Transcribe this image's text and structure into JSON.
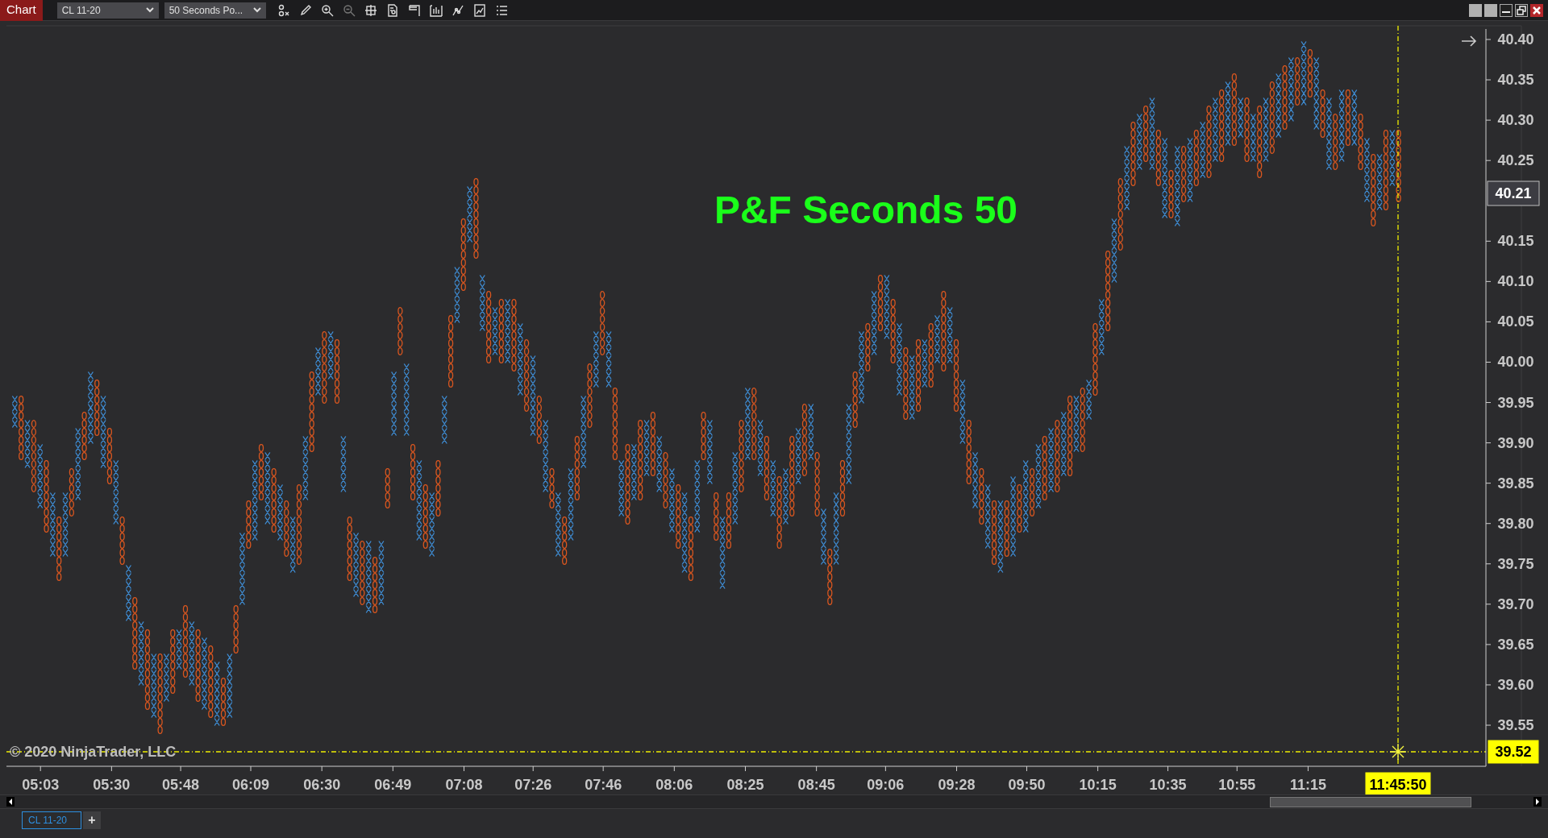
{
  "toolbar": {
    "app_tab": "Chart",
    "instrument": "CL 11-20",
    "bar_type": "50 Seconds Po..."
  },
  "chart": {
    "title": "P&F Seconds 50",
    "price_ticks": [
      "40.40",
      "40.35",
      "40.30",
      "40.25",
      "40.15",
      "40.10",
      "40.05",
      "40.00",
      "39.95",
      "39.90",
      "39.85",
      "39.80",
      "39.75",
      "39.70",
      "39.65",
      "39.60",
      "39.55"
    ],
    "time_ticks": [
      "05:03",
      "05:30",
      "05:48",
      "06:09",
      "06:30",
      "06:49",
      "07:08",
      "07:26",
      "07:46",
      "08:06",
      "08:25",
      "08:45",
      "09:06",
      "09:28",
      "09:50",
      "10:15",
      "10:35",
      "10:55",
      "11:15"
    ],
    "current_price": "40.21",
    "crosshair_price": "39.52",
    "crosshair_time": "11:45:50",
    "copyright": "© 2020 NinjaTrader, LLC"
  },
  "bottom_tabs": [
    {
      "label": "CL 11-20",
      "selected": true
    }
  ],
  "add_tab": "+"
}
